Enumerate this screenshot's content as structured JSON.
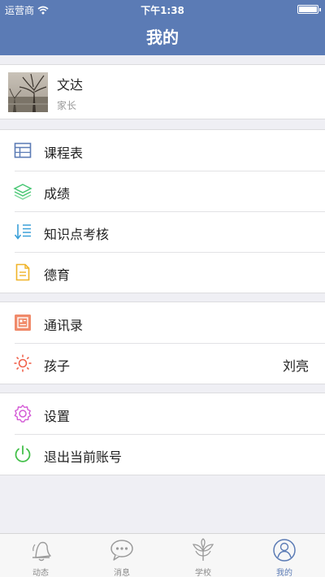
{
  "status_bar": {
    "carrier": "运营商",
    "time": "下午1:38"
  },
  "nav": {
    "title": "我的"
  },
  "profile": {
    "name": "文达",
    "role": "家长"
  },
  "groups": [
    {
      "items": [
        {
          "label": "课程表",
          "icon": "timetable-icon"
        },
        {
          "label": "成绩",
          "icon": "layers-icon"
        },
        {
          "label": "知识点考核",
          "icon": "sort-list-icon"
        },
        {
          "label": "德育",
          "icon": "document-icon"
        }
      ]
    },
    {
      "items": [
        {
          "label": "通讯录",
          "icon": "contacts-icon"
        },
        {
          "label": "孩子",
          "icon": "sun-icon",
          "value": "刘亮"
        }
      ]
    },
    {
      "items": [
        {
          "label": "设置",
          "icon": "gear-icon"
        },
        {
          "label": "退出当前账号",
          "icon": "power-icon"
        }
      ]
    }
  ],
  "tabbar": {
    "tabs": [
      {
        "label": "动态",
        "icon": "bell-icon"
      },
      {
        "label": "消息",
        "icon": "chat-bubble-icon"
      },
      {
        "label": "学校",
        "icon": "sprout-icon"
      },
      {
        "label": "我的",
        "icon": "user-icon",
        "active": true
      }
    ]
  },
  "colors": {
    "brand": "#5b7bb5",
    "timetable": "#5b7bb5",
    "grades": "#48c774",
    "knowledge": "#3aa0d8",
    "moral": "#f0b429",
    "contacts": "#f08a6a",
    "child": "#f0604a",
    "settings": "#d45bd6",
    "logout": "#44c04a"
  }
}
